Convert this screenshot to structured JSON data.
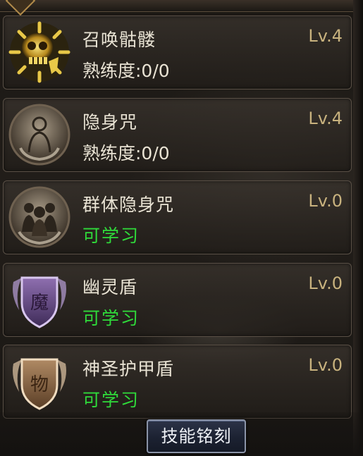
{
  "skills": [
    {
      "name": "召唤骷髅",
      "level": "Lv.4",
      "sub": "熟练度:0/0",
      "icon": "summon-skeleton-icon"
    },
    {
      "name": "隐身咒",
      "level": "Lv.4",
      "sub": "熟练度:0/0",
      "icon": "invisibility-icon"
    },
    {
      "name": "群体隐身咒",
      "level": "Lv.0",
      "sub": "可学习",
      "icon": "mass-invisibility-icon"
    },
    {
      "name": "幽灵盾",
      "level": "Lv.0",
      "sub": "可学习",
      "icon": "ghost-shield-icon",
      "glyph": "魔"
    },
    {
      "name": "神圣护甲盾",
      "level": "Lv.0",
      "sub": "可学习",
      "icon": "holy-armor-shield-icon",
      "glyph": "物"
    }
  ],
  "engrave_button": "技能铭刻",
  "colors": {
    "text": "#e9e3d4",
    "level": "#c8b27e",
    "learnable": "#2fdb3a",
    "button_bg": "#1c2232"
  }
}
